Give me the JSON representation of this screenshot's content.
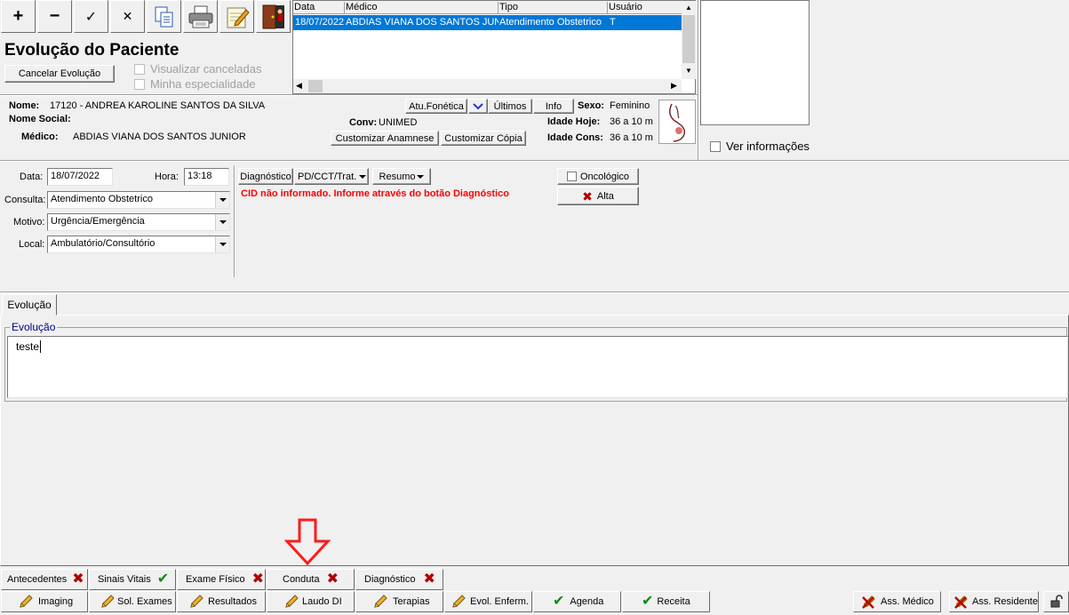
{
  "toolbar": {
    "add_label": "+",
    "remove_label": "−",
    "confirm_label": "✓",
    "cancel_label": "✕"
  },
  "header": {
    "title": "Evolução do Paciente",
    "cancel_button": "Cancelar Evolução",
    "show_cancelled": "Visualizar canceladas",
    "my_specialty": "Minha especialidade"
  },
  "history_grid": {
    "columns": [
      "Data",
      "Médico",
      "Tipo",
      "Usuário"
    ],
    "rows": [
      {
        "data": "18/07/2022",
        "medico": "ABDIAS VIANA DOS SANTOS JUNIC",
        "tipo": "Atendimento Obstetrico",
        "usuario": "T"
      }
    ]
  },
  "right_panel": {
    "ver_informacoes": "Ver informações"
  },
  "patient": {
    "nome_label": "Nome:",
    "nome_value": "17120 - ANDREA  KAROLINE SANTOS DA SILVA",
    "nome_social_label": "Nome Social:",
    "medico_label": "Médico:",
    "medico_value": "ABDIAS VIANA DOS SANTOS JUNIOR",
    "conv_label": "Conv:",
    "conv_value": "UNIMED",
    "sexo_label": "Sexo:",
    "sexo_value": "Feminino",
    "idade_hoje_label": "Idade Hoje:",
    "idade_hoje_value": "36 a 10 m",
    "idade_cons_label": "Idade Cons:",
    "idade_cons_value": "36 a 10 m",
    "btn_fonetica": "Atu.Fonética",
    "btn_ultimos": "Últimos",
    "btn_info": "Info",
    "btn_anamnese": "Customizar Anamnese",
    "btn_copia": "Customizar Cópia"
  },
  "form": {
    "data_label": "Data:",
    "data_value": "18/07/2022",
    "hora_label": "Hora:",
    "hora_value": "13:18",
    "consulta_label": "Consulta:",
    "consulta_value": "Atendimento Obstetrico",
    "motivo_label": "Motivo:",
    "motivo_value": "Urgência/Emergência",
    "local_label": "Local:",
    "local_value": "Ambulatório/Consultório",
    "btn_diagnostico": "Diagnóstico",
    "btn_pdcct": "PD/CCT/Trat.",
    "btn_resumo": "Resumo",
    "cid_warning": "CID não informado. Informe através do botão Diagnóstico",
    "oncologico": "Oncológico",
    "alta": "Alta"
  },
  "evolucao": {
    "tab_label": "Evolução",
    "group_label": "Evolução",
    "text": "teste"
  },
  "bottom_tabs_row1": [
    {
      "label": "Antecedentes",
      "status": "x"
    },
    {
      "label": "Sinais Vitais",
      "status": "check"
    },
    {
      "label": "Exame Físico",
      "status": "x"
    },
    {
      "label": "Conduta",
      "status": "x"
    },
    {
      "label": "Diagnóstico",
      "status": "x"
    }
  ],
  "bottom_tabs_row2": [
    {
      "label": "Imaging",
      "icon": "pencil"
    },
    {
      "label": "Sol. Exames",
      "icon": "pencil"
    },
    {
      "label": "Resultados",
      "icon": "pencil"
    },
    {
      "label": "Laudo DI",
      "icon": "pencil"
    },
    {
      "label": "Terapias",
      "icon": "pencil"
    },
    {
      "label": "Evol. Enferm.",
      "icon": "pencil"
    },
    {
      "label": "Agenda",
      "icon": "check"
    },
    {
      "label": "Receita",
      "icon": "check"
    }
  ],
  "sign_buttons": {
    "ass_medico": "Ass. Médico",
    "ass_residente": "Ass. Residente"
  },
  "colors": {
    "selection": "#0078d7",
    "warning": "#ff0000",
    "group_title": "#000080"
  }
}
